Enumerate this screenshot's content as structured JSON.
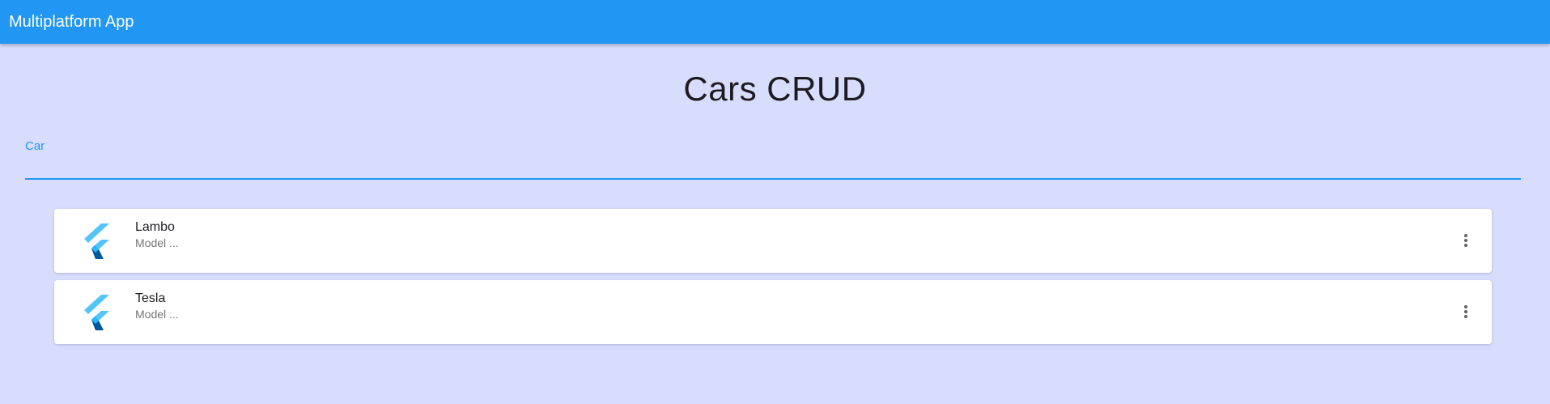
{
  "app_bar": {
    "title": "Multiplatform App",
    "color": "#2196f3"
  },
  "page": {
    "title": "Cars CRUD",
    "background": "#d8ddfe"
  },
  "car_field": {
    "label": "Car",
    "value": "",
    "accent": "#2196f3"
  },
  "cars": [
    {
      "name": "Lambo",
      "subtitle": "Model ...",
      "icon": "flutter-logo-icon",
      "action_icon": "more-vert-icon"
    },
    {
      "name": "Tesla",
      "subtitle": "Model ...",
      "icon": "flutter-logo-icon",
      "action_icon": "more-vert-icon"
    }
  ]
}
